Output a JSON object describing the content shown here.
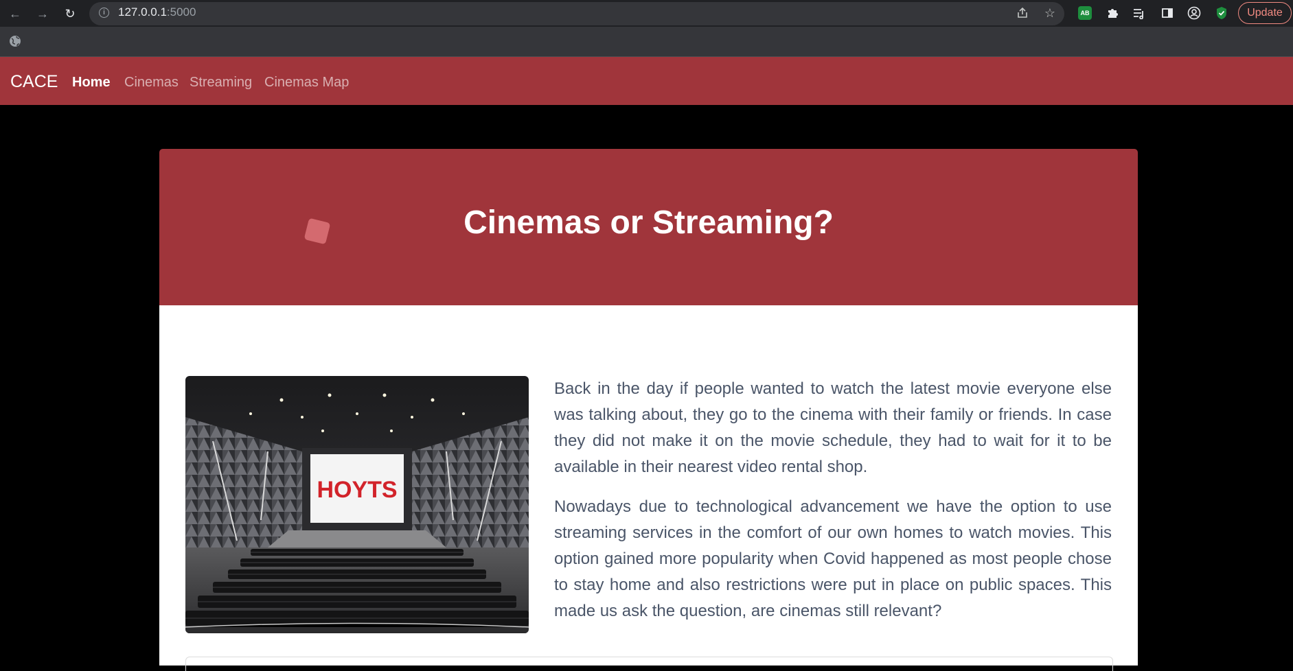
{
  "browser": {
    "url_host": "127.0.0.1",
    "url_port": ":5000",
    "update_label": "Update",
    "extension_ab_label": "AB"
  },
  "site": {
    "brand": "CACE",
    "nav": [
      {
        "label": "Home",
        "active": true
      },
      {
        "label": "Cinemas",
        "active": false
      },
      {
        "label": "Streaming",
        "active": false
      },
      {
        "label": "Cinemas Map",
        "active": false
      }
    ]
  },
  "hero": {
    "title": "Cinemas or Streaming?"
  },
  "content": {
    "image": {
      "screen_text": "HOYTS"
    },
    "paragraphs": [
      "Back in the day if people wanted to watch the latest movie everyone else was talking about, they go to the cinema with their family or friends. In case they did not make it on the movie schedule, they had to wait for it to be available in their nearest video rental shop.",
      "Nowadays due to technological advancement we have the option to use streaming services in the comfort of our own homes to watch movies. This option gained more popularity when Covid happened as most people chose to stay home and also restrictions were put in place on public spaces. This made us ask the question, are cinemas still relevant?"
    ]
  },
  "colors": {
    "brand_red": "#a0353b",
    "text_gray": "#4a5568"
  }
}
